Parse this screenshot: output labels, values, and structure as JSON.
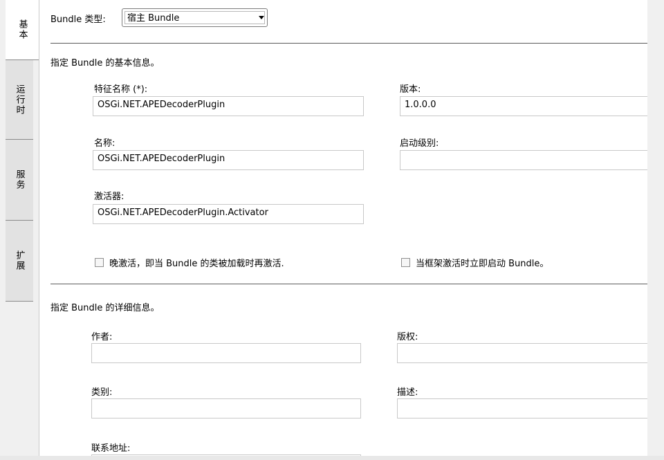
{
  "tabs": [
    {
      "label": "基本",
      "active": true
    },
    {
      "label": "运行时",
      "active": false
    },
    {
      "label": "服务",
      "active": false
    },
    {
      "label": "扩展",
      "active": false
    }
  ],
  "bundle_type": {
    "label": "Bundle 类型:",
    "value": "宿主 Bundle"
  },
  "basic_section": {
    "heading": "指定 Bundle 的基本信息。",
    "symbolic_name": {
      "label": "特征名称 (*):",
      "value": "OSGi.NET.APEDecoderPlugin"
    },
    "version": {
      "label": "版本:",
      "value": "1.0.0.0"
    },
    "name": {
      "label": "名称:",
      "value": "OSGi.NET.APEDecoderPlugin"
    },
    "start_level": {
      "label": "启动级别:",
      "value": ""
    },
    "activator": {
      "label": "激活器:",
      "value": "OSGi.NET.APEDecoderPlugin.Activator"
    },
    "lazy_activation": {
      "label": "晚激活，即当 Bundle 的类被加载时再激活.",
      "checked": false
    },
    "start_on_framework": {
      "label": "当框架激活时立即启动 Bundle。",
      "checked": false
    }
  },
  "detail_section": {
    "heading": "指定 Bundle 的详细信息。",
    "author": {
      "label": "作者:",
      "value": ""
    },
    "copyright": {
      "label": "版权:",
      "value": ""
    },
    "category": {
      "label": "类别:",
      "value": ""
    },
    "description": {
      "label": "描述:",
      "value": ""
    },
    "contact": {
      "label": "联系地址:",
      "value": ""
    }
  }
}
